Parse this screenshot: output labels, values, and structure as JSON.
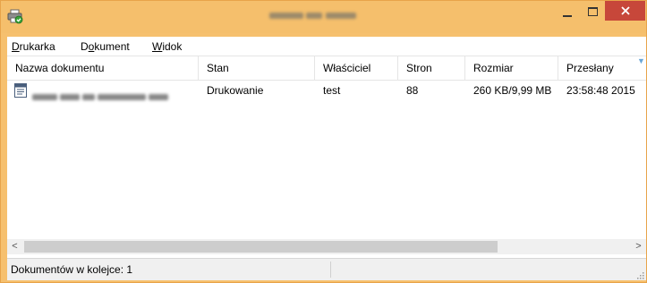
{
  "window": {
    "title": "",
    "colors": {
      "frame": "#f6c06e",
      "close": "#c7473a"
    }
  },
  "menu": [
    {
      "pre": "",
      "key": "D",
      "post": "rukarka"
    },
    {
      "pre": "D",
      "key": "o",
      "post": "kument"
    },
    {
      "pre": "",
      "key": "W",
      "post": "idok"
    }
  ],
  "table": {
    "columns": [
      "Nazwa dokumentu",
      "Stan",
      "Właściciel",
      "Stron",
      "Rozmiar",
      "Przesłany"
    ],
    "rows": [
      {
        "name": "",
        "status": "Drukowanie",
        "owner": "test",
        "pages": "88",
        "size": "260 KB/9,99 MB",
        "submitted": "23:58:48  2015"
      }
    ]
  },
  "statusbar": {
    "text": "Dokumentów w kolejce: 1"
  }
}
